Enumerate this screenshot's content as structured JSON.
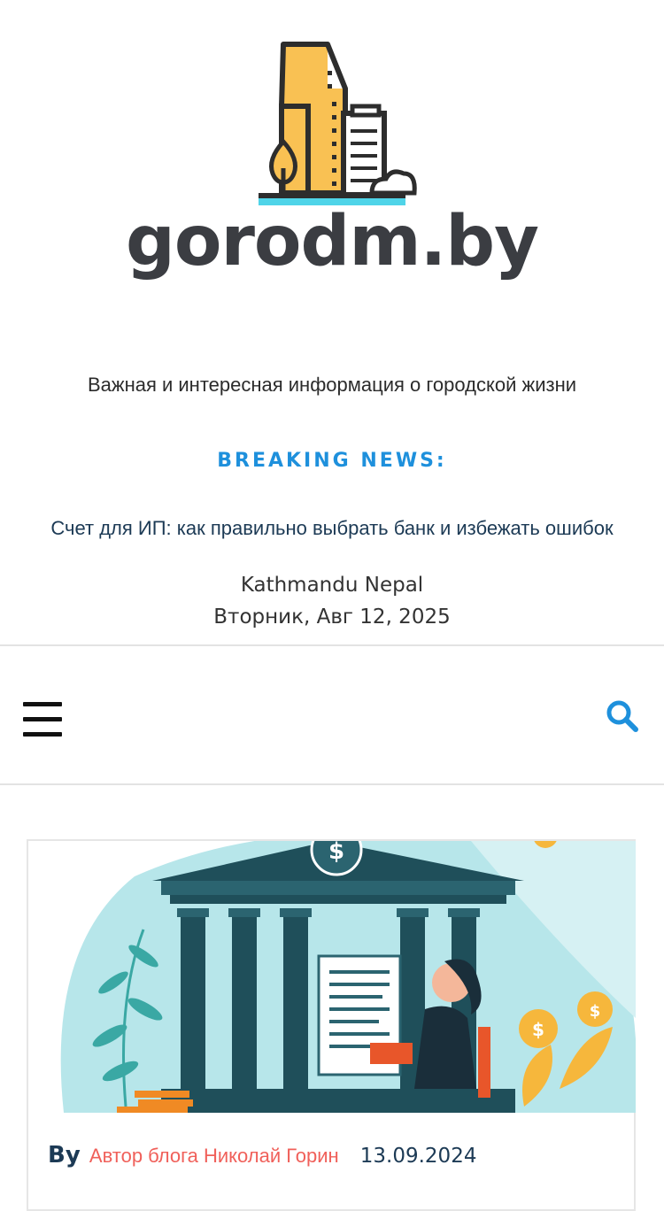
{
  "site": {
    "logo_text": "gorodm.by",
    "tagline": "Важная и интересная информация о городской жизни"
  },
  "breaking": {
    "label": "BREAKING NEWS:",
    "item": "Счет для ИП: как правильно выбрать банк и избежать ошибок"
  },
  "meta": {
    "location": "Kathmandu Nepal",
    "date": "Вторник, Авг 12, 2025"
  },
  "nav": {
    "menu_icon": "hamburger-icon",
    "search_icon": "search-icon"
  },
  "post": {
    "by_label": "By",
    "author": "Автор блога Николай Горин",
    "date": "13.09.2024"
  },
  "colors": {
    "accent": "#1e90dc",
    "author": "#f0605a",
    "dark_text": "#1c3a55",
    "logo_yellow": "#f9c153",
    "logo_cyan": "#4fd4e8"
  }
}
